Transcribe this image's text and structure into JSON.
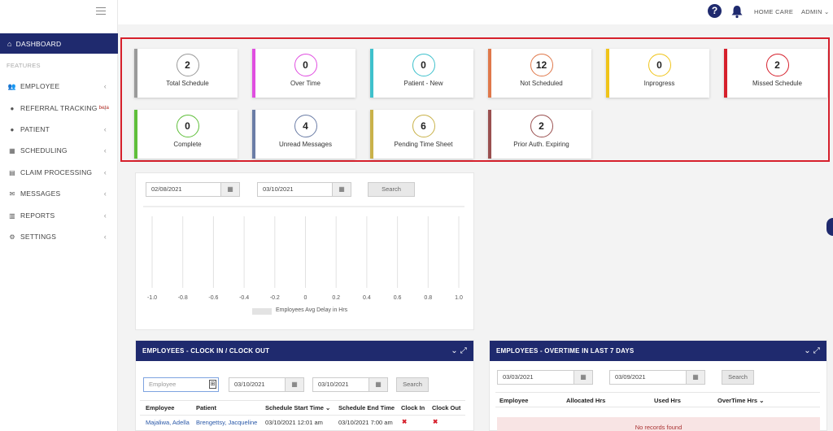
{
  "topbar": {
    "org": "HOME CARE",
    "user": "ADMIN ⌄"
  },
  "sidebar": {
    "dashboard": "DASHBOARD",
    "section": "FEATURES",
    "items": [
      {
        "label": "EMPLOYEE",
        "icon": "users-icon"
      },
      {
        "label": "REFERRAL TRACKING",
        "badge": "beta",
        "icon": "user-icon"
      },
      {
        "label": "PATIENT",
        "icon": "user-icon"
      },
      {
        "label": "SCHEDULING",
        "icon": "calendar-icon"
      },
      {
        "label": "CLAIM PROCESSING",
        "icon": "file-icon"
      },
      {
        "label": "MESSAGES",
        "icon": "envelope-icon"
      },
      {
        "label": "REPORTS",
        "icon": "bar-chart-icon"
      },
      {
        "label": "SETTINGS",
        "icon": "gear-icon"
      }
    ]
  },
  "cards": [
    {
      "value": "2",
      "label": "Total Schedule",
      "color": "#9a9a9a"
    },
    {
      "value": "0",
      "label": "Over Time",
      "color": "#e04ee0"
    },
    {
      "value": "0",
      "label": "Patient - New",
      "color": "#3fc1cc"
    },
    {
      "value": "12",
      "label": "Not Scheduled",
      "color": "#e0784a"
    },
    {
      "value": "0",
      "label": "Inprogress",
      "color": "#f0c419"
    },
    {
      "value": "2",
      "label": "Missed Schedule",
      "color": "#d6202c"
    },
    {
      "value": "0",
      "label": "Complete",
      "color": "#5fbf3a"
    },
    {
      "value": "4",
      "label": "Unread Messages",
      "color": "#6b7da6"
    },
    {
      "value": "6",
      "label": "Pending Time Sheet",
      "color": "#c9b24a"
    },
    {
      "value": "2",
      "label": "Prior Auth. Expiring",
      "color": "#9a5050"
    }
  ],
  "chart_filter": {
    "from": "02/08/2021",
    "to": "03/10/2021",
    "search": "Search"
  },
  "chart_data": {
    "type": "bar",
    "x_ticks": [
      "-1.0",
      "-0.8",
      "-0.6",
      "-0.4",
      "-0.2",
      "0",
      "0.2",
      "0.4",
      "0.6",
      "0.8",
      "1.0"
    ],
    "xlim": [
      -1.0,
      1.0
    ],
    "series": [
      {
        "name": "Employees Avg Delay in Hrs",
        "values": []
      }
    ],
    "grid": true,
    "legend": "bottom"
  },
  "clock_panel": {
    "title": "EMPLOYEES - CLOCK IN / CLOCK OUT",
    "employee_placeholder": "Employee",
    "from": "03/10/2021",
    "to": "03/10/2021",
    "search": "Search",
    "columns": [
      "Employee",
      "Patient",
      "Schedule Start Time ⌄",
      "Schedule End Time",
      "Clock In",
      "Clock Out"
    ],
    "rows": [
      {
        "employee": "Majaliwa, Adella",
        "patient": "Brengettsy, Jacqueline",
        "start": "03/10/2021 12:01 am",
        "end": "03/10/2021 7:00 am",
        "clock_in": "✖",
        "clock_out": "✖"
      }
    ]
  },
  "overtime_panel": {
    "title": "EMPLOYEES - OVERTIME IN LAST 7 DAYS",
    "from": "03/03/2021",
    "to": "03/09/2021",
    "search": "Search",
    "columns": [
      "Employee",
      "Allocated Hrs",
      "Used Hrs",
      "OverTime Hrs ⌄"
    ],
    "empty": "No records found"
  }
}
